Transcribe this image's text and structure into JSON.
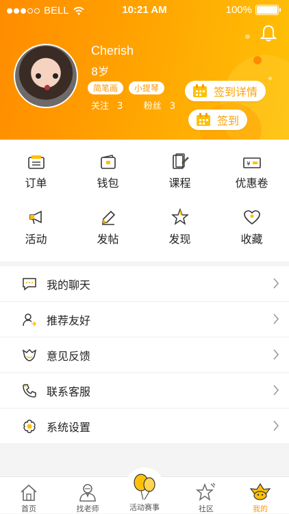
{
  "status_bar": {
    "carrier": "BELL",
    "time": "10:21 AM",
    "battery": "100%"
  },
  "profile": {
    "name": "Cherish",
    "age": "8岁",
    "tags": [
      "简笔画",
      "小提琴"
    ],
    "following_label": "关注",
    "following_count": "3",
    "fans_label": "粉丝",
    "fans_count": "3",
    "sign_detail_label": "签到详情",
    "sign_label": "签到"
  },
  "grid": [
    {
      "label": "订单",
      "icon": "order-icon"
    },
    {
      "label": "钱包",
      "icon": "wallet-icon"
    },
    {
      "label": "课程",
      "icon": "course-icon"
    },
    {
      "label": "优惠卷",
      "icon": "coupon-icon"
    },
    {
      "label": "活动",
      "icon": "megaphone-icon"
    },
    {
      "label": "发帖",
      "icon": "pencil-icon"
    },
    {
      "label": "发现",
      "icon": "star-icon"
    },
    {
      "label": "收藏",
      "icon": "heart-icon"
    }
  ],
  "list": [
    {
      "label": "我的聊天",
      "icon": "chat-icon"
    },
    {
      "label": "推荐友好",
      "icon": "user-recommend-icon"
    },
    {
      "label": "意见反馈",
      "icon": "feedback-icon"
    },
    {
      "label": "联系客服",
      "icon": "phone-icon"
    },
    {
      "label": "系统设置",
      "icon": "settings-icon"
    }
  ],
  "tabs": [
    {
      "label": "首页",
      "icon": "home-icon"
    },
    {
      "label": "找老师",
      "icon": "teacher-icon"
    },
    {
      "label": "活动赛事",
      "icon": "balloon-icon"
    },
    {
      "label": "社区",
      "icon": "community-icon"
    },
    {
      "label": "我的",
      "icon": "profile-icon",
      "active": true
    }
  ],
  "colors": {
    "accent": "#ff9800",
    "header_start": "#ff8c00",
    "header_end": "#ffc107"
  }
}
